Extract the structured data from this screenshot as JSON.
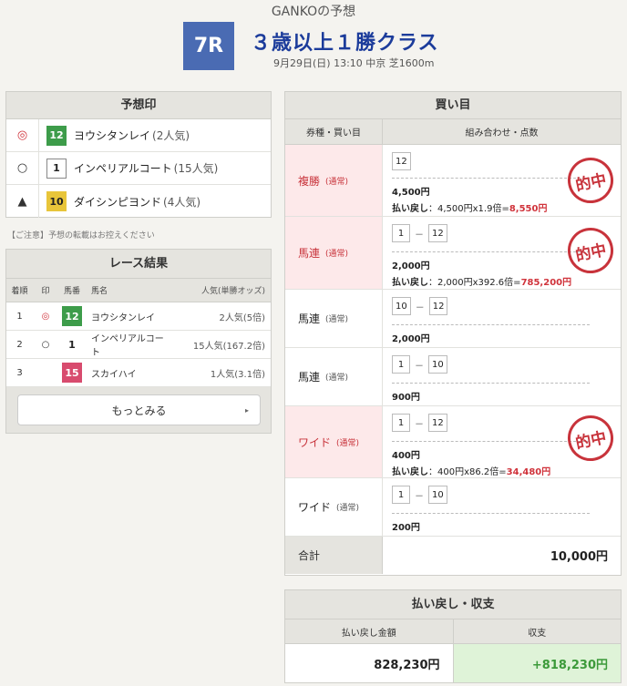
{
  "header": {
    "predictor": "GANKOの予想",
    "race_no": "7R",
    "race_title": "３歳以上１勝クラス",
    "race_sub": "9月29日(日) 13:10 中京 芝1600m"
  },
  "yosou": {
    "title": "予想印",
    "rows": [
      {
        "mark": "◎",
        "num": "12",
        "name": "ヨウシタンレイ",
        "pop": "(2人気)"
      },
      {
        "mark": "○",
        "num": "1",
        "name": "インペリアルコート",
        "pop": "(15人気)"
      },
      {
        "mark": "▲",
        "num": "10",
        "name": "ダイシンピヨンド",
        "pop": "(4人気)"
      }
    ],
    "caution": "【ご注意】予想の転載はお控えください"
  },
  "result": {
    "title": "レース結果",
    "headers": {
      "rank": "着順",
      "mark": "印",
      "num": "馬番",
      "name": "馬名",
      "pop": "人気(単勝オッズ)"
    },
    "rows": [
      {
        "rank": "1",
        "mark": "◎",
        "num": "12",
        "name": "ヨウシタンレイ",
        "pop": "2人気(5倍)"
      },
      {
        "rank": "2",
        "mark": "○",
        "num": "1",
        "name": "インペリアルコート",
        "pop": "15人気(167.2倍)"
      },
      {
        "rank": "3",
        "mark": "",
        "num": "15",
        "name": "スカイハイ",
        "pop": "1人気(3.1倍)"
      }
    ],
    "more": "もっとみる",
    "more_arrow": "▸"
  },
  "buy": {
    "title": "買い目",
    "col1": "券種・買い目",
    "col2": "組み合わせ・点数",
    "dash": "－",
    "stamp": "的中",
    "rows": [
      {
        "type": "複勝",
        "sub": "(通常)",
        "combo": [
          "12"
        ],
        "amount": "4,500円",
        "pay_label": "払い戻し",
        "pay_calc": "：4,500円x1.9倍=",
        "pay_total": "8,550円"
      },
      {
        "type": "馬連",
        "sub": "(通常)",
        "combo": [
          "1",
          "12"
        ],
        "amount": "2,000円",
        "pay_label": "払い戻し",
        "pay_calc": "：2,000円x392.6倍=",
        "pay_total": "785,200円"
      },
      {
        "type": "馬連",
        "sub": "(通常)",
        "combo": [
          "10",
          "12"
        ],
        "amount": "2,000円"
      },
      {
        "type": "馬連",
        "sub": "(通常)",
        "combo": [
          "1",
          "10"
        ],
        "amount": "900円"
      },
      {
        "type": "ワイド",
        "sub": "(通常)",
        "combo": [
          "1",
          "12"
        ],
        "amount": "400円",
        "pay_label": "払い戻し",
        "pay_calc": "：400円x86.2倍=",
        "pay_total": "34,480円"
      },
      {
        "type": "ワイド",
        "sub": "(通常)",
        "combo": [
          "1",
          "10"
        ],
        "amount": "200円"
      }
    ],
    "total_label": "合計",
    "total_value": "10,000円"
  },
  "payout": {
    "title": "払い戻し・収支",
    "col1": "払い戻し金額",
    "col2": "収支",
    "payback": "828,230円",
    "balance": "+818,230円"
  },
  "colors": {
    "race_box": "#4a6bb3",
    "title_blue": "#1c3c9b",
    "hit_pink": "#fde9ea",
    "hit_red": "#c8333b",
    "plus_green": "#3c9a3a"
  }
}
